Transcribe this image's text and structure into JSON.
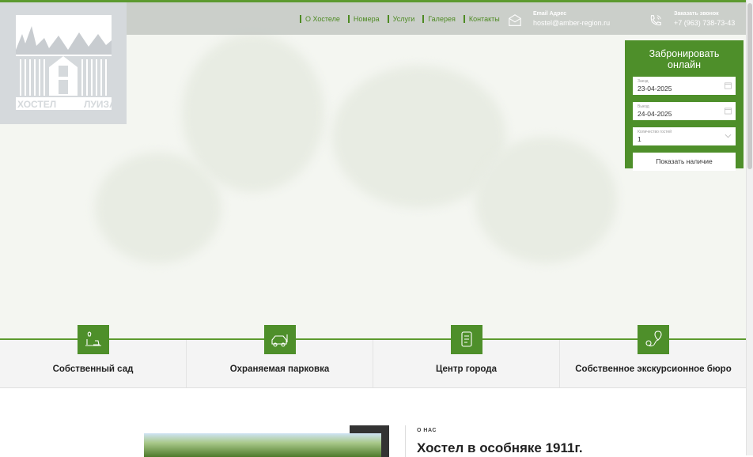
{
  "nav": {
    "items": [
      "О Хостеле",
      "Номера",
      "Услуги",
      "Галерея",
      "Контакты"
    ]
  },
  "contacts": {
    "email": {
      "label": "Email Адрес",
      "value": "hostel@amber-region.ru",
      "icon": "mail-icon"
    },
    "phone": {
      "label": "Заказать звонок",
      "value": "+7 (963) 738-73-43",
      "icon": "phone-icon"
    }
  },
  "logo": {
    "text_left": "ХОСТЕЛ",
    "text_right": "ЛУИЗА"
  },
  "booking": {
    "title": "Забронировать онлайн",
    "checkin_label": "Заезд",
    "checkin_value": "23-04-2025",
    "checkout_label": "Выезд",
    "checkout_value": "24-04-2025",
    "guests_label": "Количество гостей",
    "guests_value": "1",
    "submit": "Показать наличие"
  },
  "features": [
    {
      "title": "Собственный сад",
      "icon": "garden-icon"
    },
    {
      "title": "Охраняемая парковка",
      "icon": "car-parking-icon"
    },
    {
      "title": "Центр города",
      "icon": "city-center-icon"
    },
    {
      "title": "Собственное экскурсионное бюро",
      "icon": "tour-map-icon"
    }
  ],
  "about": {
    "kicker": "О НАС",
    "title": "Хостел в особняке 1911г."
  },
  "colors": {
    "accent": "#4e8f2a",
    "nav": "#4d8a22"
  }
}
